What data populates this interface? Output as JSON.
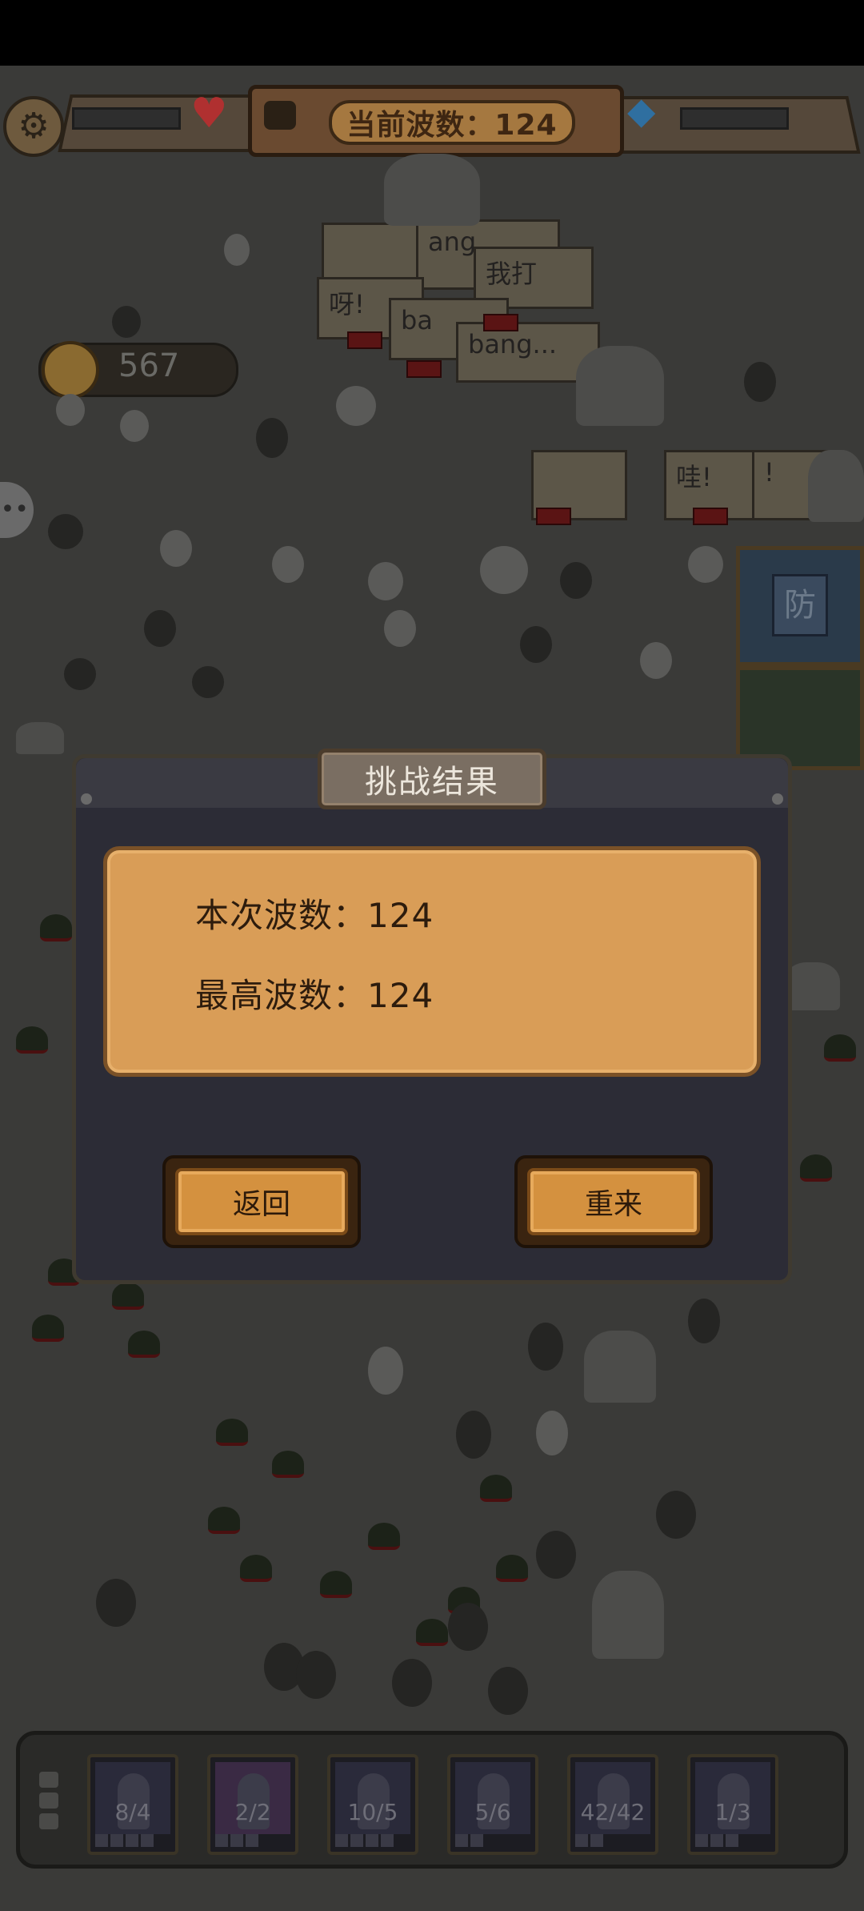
{
  "hud": {
    "wave_label": "当前波数：124",
    "coins": "567",
    "settings_icon": "gear-icon",
    "health_icon": "heart-icon",
    "resource_icon": "cube-icon"
  },
  "battle_bubbles": [
    "ang",
    "我打",
    "呀!",
    "ba",
    "bang...",
    "哇!",
    "!"
  ],
  "side_card": {
    "label": "防"
  },
  "dialog": {
    "title": "挑战结果",
    "current_wave_label": "本次波数：",
    "current_wave_value": "124",
    "best_wave_label": "最高波数：",
    "best_wave_value": "124",
    "back_label": "返回",
    "retry_label": "重来"
  },
  "units": [
    {
      "count": "8/4"
    },
    {
      "count": "2/2"
    },
    {
      "count": "10/5"
    },
    {
      "count": "5/6"
    },
    {
      "count": "42/42"
    },
    {
      "count": "1/3"
    }
  ]
}
